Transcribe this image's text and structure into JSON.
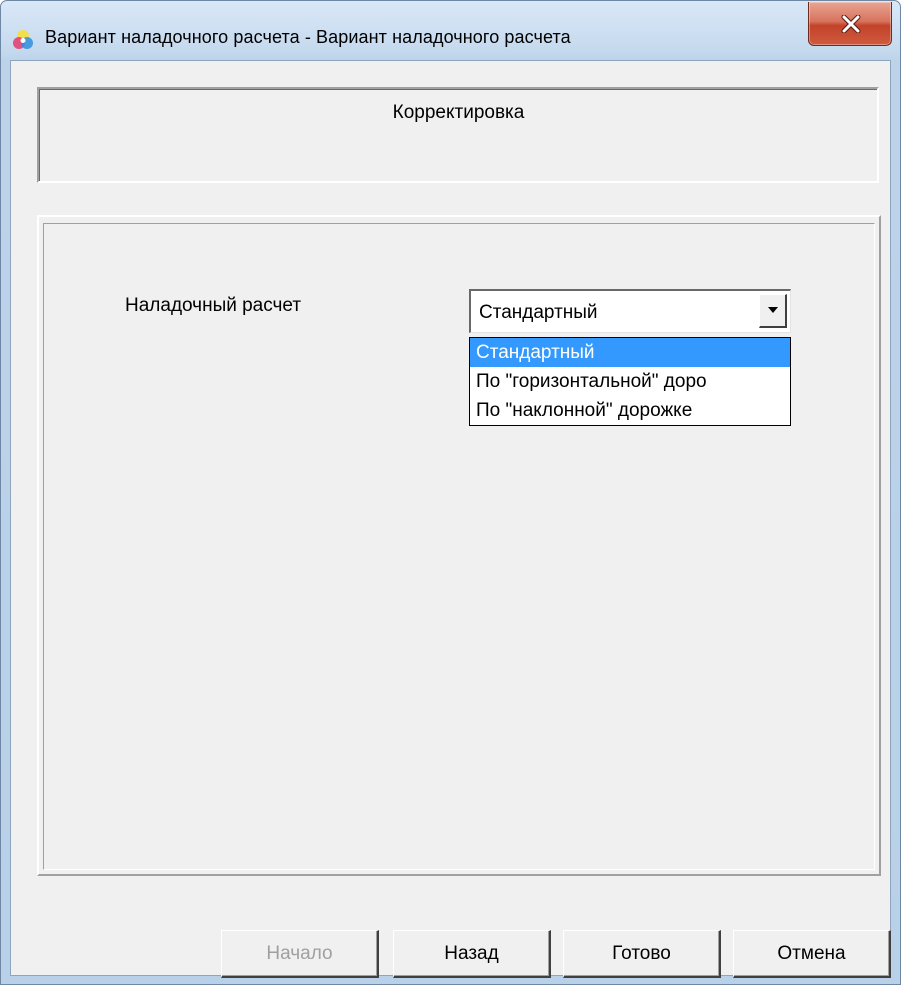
{
  "window": {
    "title": "Вариант наладочного расчета - Вариант наладочного расчета",
    "icon": "color-wheel-icon",
    "close_icon": "close-icon"
  },
  "header": {
    "title": "Корректировка"
  },
  "form": {
    "field_label": "Наладочный расчет",
    "combo": {
      "selected_value": "Стандартный",
      "options": [
        "Стандартный",
        "По \"горизонтальной\" доро",
        "По \"наклонной\" дорожке"
      ],
      "highlighted_index": 0
    }
  },
  "buttons": {
    "start": {
      "label": "Начало",
      "enabled": false
    },
    "back": {
      "label": "Назад",
      "enabled": true
    },
    "finish": {
      "label": "Готово",
      "enabled": true
    },
    "cancel": {
      "label": "Отмена",
      "enabled": true
    }
  },
  "colors": {
    "selection": "#3399ff",
    "dialog_background": "#f0f0f0",
    "close_button": "#c2432a",
    "disabled_text": "#a0a0a0"
  }
}
